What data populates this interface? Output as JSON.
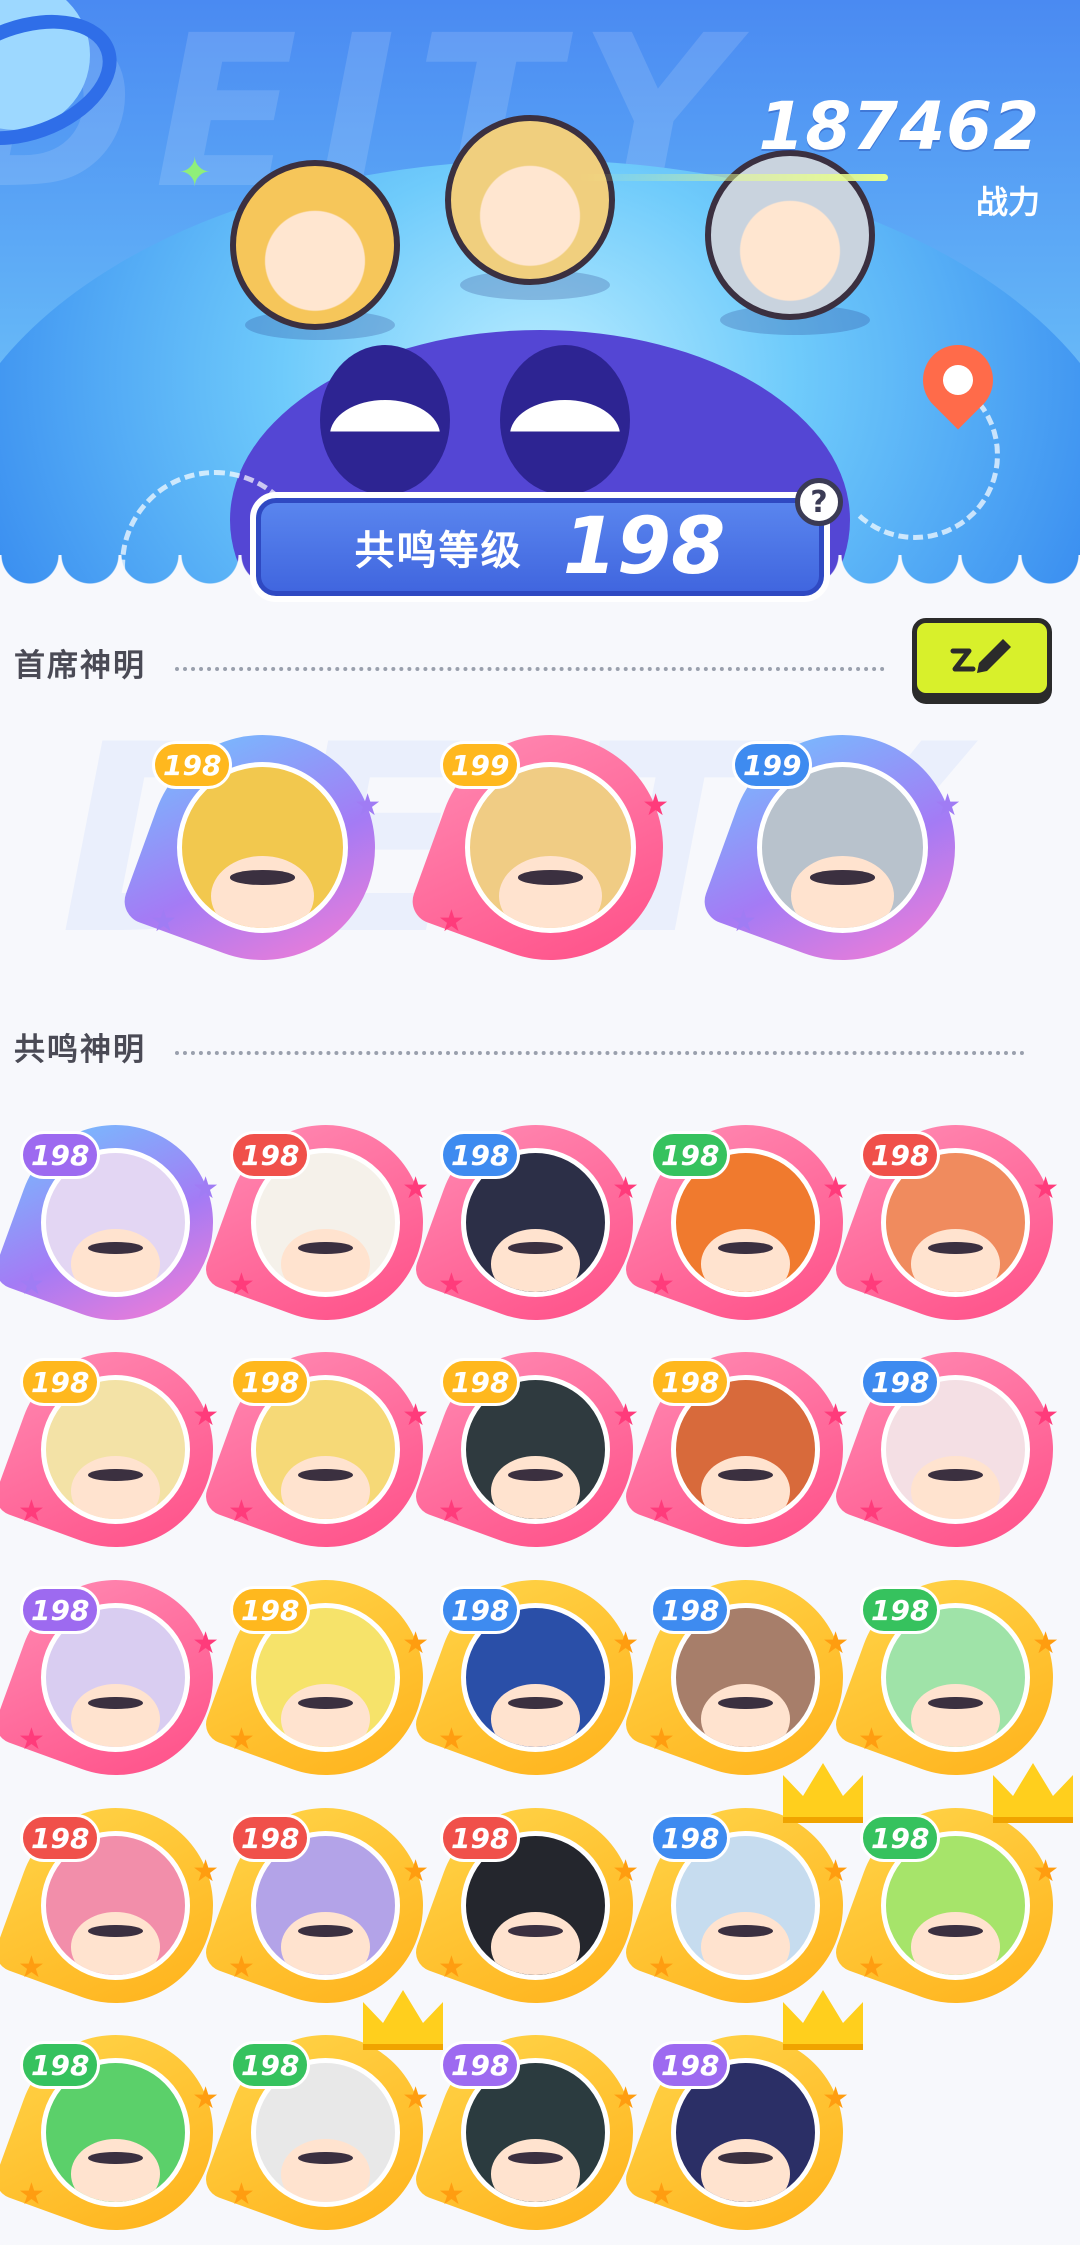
{
  "header": {
    "bg_text": "DEITY",
    "power_value": "187462",
    "power_label": "战力",
    "level_label": "共鸣等级",
    "level_value": "198",
    "help_symbol": "?"
  },
  "chief_section": {
    "title": "首席神明",
    "avatars": [
      {
        "level": "198",
        "quality": "purple",
        "level_color": "gold",
        "hair": "#f2c84e"
      },
      {
        "level": "199",
        "quality": "pink",
        "level_color": "gold",
        "hair": "#f0cc84"
      },
      {
        "level": "199",
        "quality": "purple",
        "level_color": "blue",
        "hair": "#b8c2cc"
      }
    ]
  },
  "resonance_section": {
    "title": "共鸣神明",
    "avatars": [
      {
        "level": "198",
        "quality": "purple",
        "level_color": "purple",
        "hair": "#e3d6f3",
        "crown": false
      },
      {
        "level": "198",
        "quality": "pink",
        "level_color": "red",
        "hair": "#f5f1ea",
        "crown": false
      },
      {
        "level": "198",
        "quality": "pink",
        "level_color": "blue",
        "hair": "#2c2f47",
        "crown": false
      },
      {
        "level": "198",
        "quality": "pink",
        "level_color": "green",
        "hair": "#f07a2e",
        "crown": false
      },
      {
        "level": "198",
        "quality": "pink",
        "level_color": "red",
        "hair": "#f08b5e",
        "crown": false
      },
      {
        "level": "198",
        "quality": "pink",
        "level_color": "gold",
        "hair": "#f3e2a6",
        "crown": false
      },
      {
        "level": "198",
        "quality": "pink",
        "level_color": "gold",
        "hair": "#f6d977",
        "crown": false
      },
      {
        "level": "198",
        "quality": "pink",
        "level_color": "gold",
        "hair": "#2f3a3f",
        "crown": false
      },
      {
        "level": "198",
        "quality": "pink",
        "level_color": "gold",
        "hair": "#d86a3b",
        "crown": false
      },
      {
        "level": "198",
        "quality": "pink",
        "level_color": "blue",
        "hair": "#f4dfe4",
        "crown": false
      },
      {
        "level": "198",
        "quality": "pink",
        "level_color": "purple",
        "hair": "#d9cdf1",
        "crown": false
      },
      {
        "level": "198",
        "quality": "gold",
        "level_color": "gold",
        "hair": "#f6e36a",
        "crown": false
      },
      {
        "level": "198",
        "quality": "gold",
        "level_color": "blue",
        "hair": "#2a4fa8",
        "crown": false
      },
      {
        "level": "198",
        "quality": "gold",
        "level_color": "blue",
        "hair": "#a77e6a",
        "crown": false
      },
      {
        "level": "198",
        "quality": "gold",
        "level_color": "green",
        "hair": "#9fe3a8",
        "crown": false
      },
      {
        "level": "198",
        "quality": "gold",
        "level_color": "red",
        "hair": "#f28eaa",
        "crown": false
      },
      {
        "level": "198",
        "quality": "gold",
        "level_color": "red",
        "hair": "#b3a3e8",
        "crown": false
      },
      {
        "level": "198",
        "quality": "gold",
        "level_color": "red",
        "hair": "#24262d",
        "crown": false
      },
      {
        "level": "198",
        "quality": "gold",
        "level_color": "blue",
        "hair": "#c6dcef",
        "crown": true
      },
      {
        "level": "198",
        "quality": "gold",
        "level_color": "green",
        "hair": "#a6e46a",
        "crown": true
      },
      {
        "level": "198",
        "quality": "gold",
        "level_color": "green",
        "hair": "#5bd06a",
        "crown": false
      },
      {
        "level": "198",
        "quality": "gold",
        "level_color": "green",
        "hair": "#e8e8e8",
        "crown": true
      },
      {
        "level": "198",
        "quality": "gold",
        "level_color": "purple",
        "hair": "#2b3b3f",
        "crown": false
      },
      {
        "level": "198",
        "quality": "gold",
        "level_color": "purple",
        "hair": "#2b2f66",
        "crown": true
      }
    ]
  },
  "icons": {
    "edit": "pencil-icon",
    "help": "question-icon",
    "location": "location-pin-icon"
  }
}
